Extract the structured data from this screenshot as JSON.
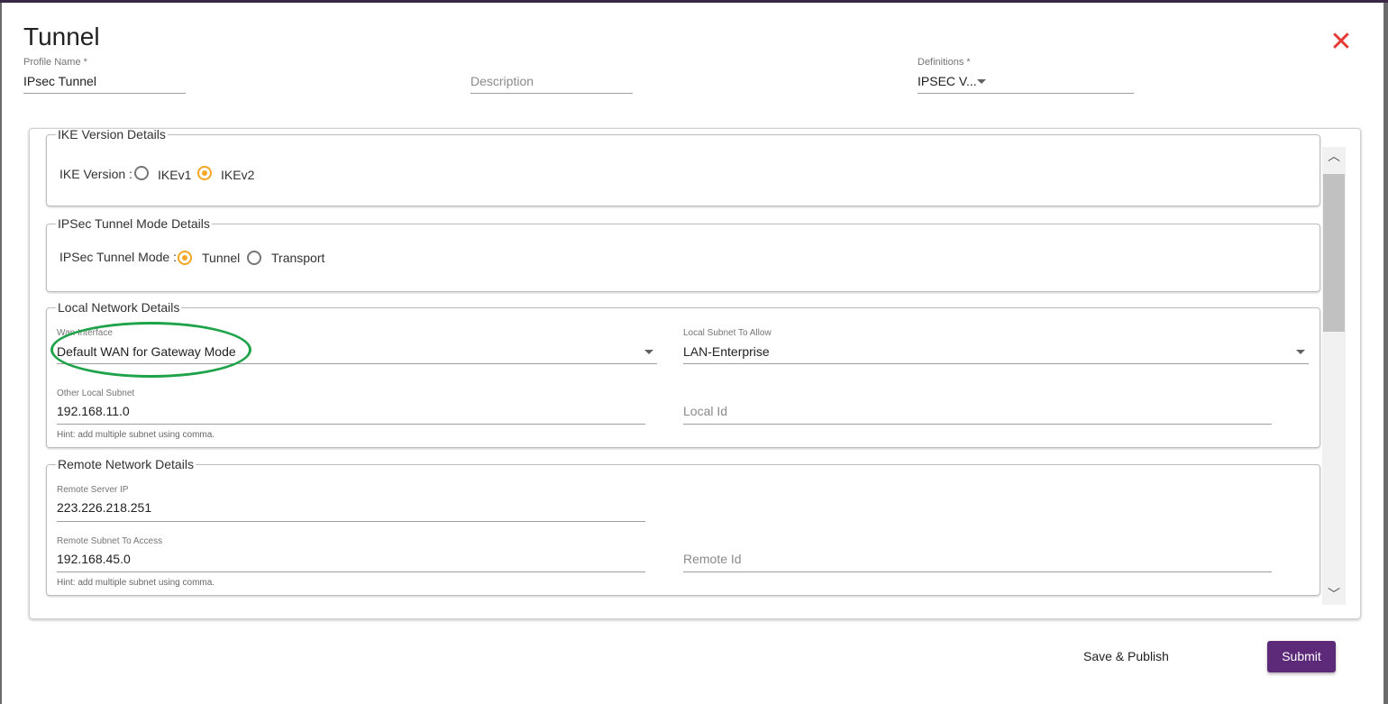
{
  "dialog": {
    "title": "Tunnel",
    "profile_name": {
      "label": "Profile Name *",
      "value": "IPsec Tunnel"
    },
    "description": {
      "placeholder": "Description"
    },
    "definitions": {
      "label": "Definitions *",
      "value": "IPSEC V..."
    }
  },
  "ike": {
    "legend": "IKE Version Details",
    "label": "IKE Version :",
    "options": [
      "IKEv1",
      "IKEv2"
    ],
    "selected": "IKEv2"
  },
  "ipsec_mode": {
    "legend": "IPSec Tunnel Mode Details",
    "label": "IPSec Tunnel Mode :",
    "options": [
      "Tunnel",
      "Transport"
    ],
    "selected": "Tunnel"
  },
  "local_network": {
    "legend": "Local Network Details",
    "wan_interface": {
      "label": "Wan Interface",
      "value": "Default WAN for Gateway Mode"
    },
    "local_subnet": {
      "label": "Local Subnet To Allow",
      "value": "LAN-Enterprise"
    },
    "other_local_subnet": {
      "label": "Other Local Subnet",
      "value": "192.168.11.0"
    },
    "local_id": {
      "placeholder": "Local Id"
    },
    "hint": "Hint: add multiple subnet using comma."
  },
  "remote_network": {
    "legend": "Remote Network Details",
    "remote_server_ip": {
      "label": "Remote Server IP",
      "value": "223.226.218.251"
    },
    "remote_subnet": {
      "label": "Remote Subnet To Access",
      "value": "192.168.45.0"
    },
    "remote_id": {
      "placeholder": "Remote Id"
    },
    "hint": "Hint: add multiple subnet using comma."
  },
  "footer": {
    "save_publish": "Save & Publish",
    "submit": "Submit"
  },
  "colors": {
    "accent_radio": "#f5a623",
    "submit_bg": "#5c2a78",
    "close_icon": "#e53935",
    "annotation": "#1fa34a"
  },
  "icons": {
    "close": "close-icon",
    "dropdown": "chevron-down-icon",
    "scroll_up": "chevron-up-icon",
    "scroll_down": "chevron-down-icon"
  }
}
